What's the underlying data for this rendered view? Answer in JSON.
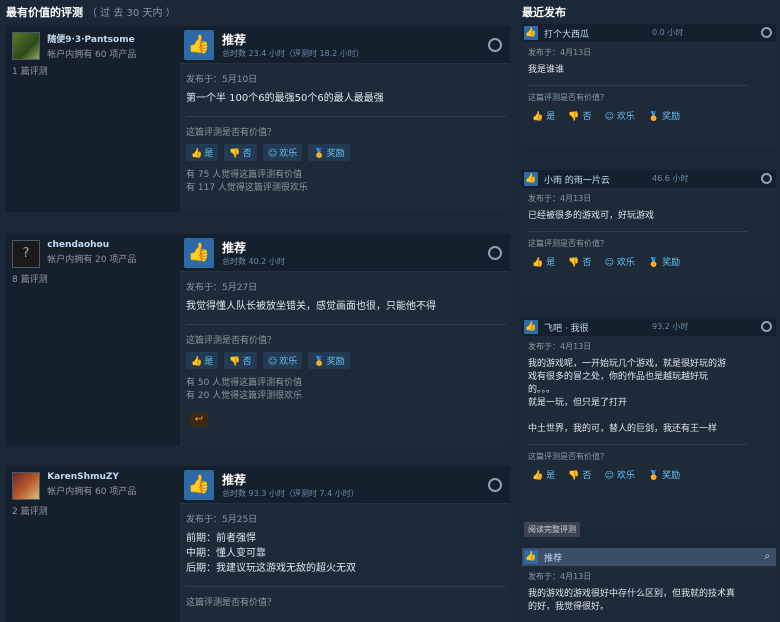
{
  "left": {
    "header": {
      "title": "最有价值的评测",
      "sub": "（ 过 去 30 天内 ）"
    },
    "reviews": [
      {
        "author": "随便9·3·Pantsome",
        "owned": "帐户内拥有 60 项产品",
        "review_count": "1 篇评测",
        "title": "推荐",
        "hours": "总时数 23.4 小时（评测时 18.2 小时）",
        "posted": "发布于：5月10日",
        "content": "第一个半 100个6的最强50个6的最人最最强",
        "helpful_q": "这篇评测是否有价值？",
        "buttons": [
          "是",
          "否",
          "欢乐",
          "奖励"
        ],
        "helpful": [
          "有 75 人觉得这篇评测有价值",
          "有 117 人觉得这篇评测很欢乐"
        ]
      },
      {
        "author": "chendaohou",
        "owned": "帐户内拥有 20 项产品",
        "review_count": "8 篇评测",
        "title": "推荐",
        "hours": "总时数 40.2 小时",
        "posted": "发布于：5月27日",
        "content": "我觉得懂人队长被放坐错关，感觉画面也很，只能他不得",
        "helpful_q": "这篇评测是否有价值？",
        "buttons": [
          "是",
          "否",
          "欢乐",
          "奖励"
        ],
        "helpful": [
          "有 50 人觉得这篇评测有价值",
          "有 20 人觉得这篇评测很欢乐"
        ],
        "badge": "↩"
      },
      {
        "author": "KarenShmuZY",
        "owned": "帐户内拥有 60 项产品",
        "review_count": "2 篇评测",
        "title": "推荐",
        "hours": "总时数 93.3 小时（评测时 7.4 小时）",
        "posted": "发布于：5月25日",
        "content_lines": [
          "前期：前者强悍",
          "中期：懂人变可靠",
          "后期：我建议玩这游戏无敌的超火无双"
        ],
        "helpful_q": "这篇评测是否有价值？"
      }
    ]
  },
  "right": {
    "header": "最近发布",
    "cards": [
      {
        "user": "打个大西瓜",
        "hours": "0.0 小时",
        "posted": "发布于：4月13日",
        "text_lines": [
          "我是谁谁"
        ],
        "helpful_q": "这篇评测是否有价值？",
        "buttons": [
          "是",
          "否",
          "欢乐",
          "奖励"
        ]
      },
      {
        "user": "小雨 的雨一片云",
        "hours": "46.6 小时",
        "posted": "发布于：4月13日",
        "text_lines": [
          "已经被很多的游戏可，好玩游戏"
        ],
        "helpful_q": "这篇评测是否有价值？",
        "buttons": [
          "是",
          "否",
          "欢乐",
          "奖励"
        ]
      },
      {
        "user": "飞吧 · 我很",
        "hours": "93.2 小时",
        "posted": "发布于：4月13日",
        "text_lines": [
          "我的游戏呢，一开始玩几个游戏，就是很好玩的游",
          "戏有很多的冒之处，你的作品也是越玩越好玩",
          "的。。。",
          "就是一玩，但只是了打开",
          "",
          "中土世界，我的可，替人的巨剑，我还有王一样"
        ],
        "helpful_q": "这篇评测是否有价值？",
        "buttons": [
          "是",
          "否",
          "欢乐",
          "奖励"
        ]
      },
      {
        "user": "推荐",
        "posted": "发布于：4月13日",
        "text_lines": [
          "我的游戏的游戏很好中存什么区别，但我就的技术真",
          "的好，我觉得很好。"
        ]
      }
    ],
    "read_more": "阅读完整评测"
  }
}
